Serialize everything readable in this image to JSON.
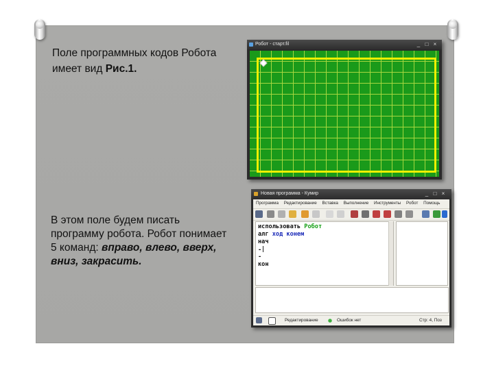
{
  "slide": {
    "paragraph1_text": "Поле  программных кодов Робота",
    "paragraph1_line2_prefix": "имеет вид ",
    "paragraph1_figure": "Рис.1.",
    "paragraph2_line1": "В  этом  поле  будем  писать",
    "paragraph2_line2": "программу  робота.  Робот  понимает",
    "paragraph2_line3_prefix": "5  команд:  ",
    "paragraph2_commands_a": "вправо,  влево,  вверх,",
    "paragraph2_commands_b": "вниз, закрасить."
  },
  "robot_window": {
    "title": "Робот - старт.fil",
    "minimize": "_",
    "maximize": "□",
    "close": "×"
  },
  "kumir_window": {
    "title": "Новая программа - Кумир",
    "minimize": "_",
    "maximize": "□",
    "close": "×",
    "menu": [
      "Программа",
      "Редактирование",
      "Вставка",
      "Выполнение",
      "Инструменты",
      "Робот",
      "Помощь"
    ],
    "code": {
      "line1_kw": "использовать",
      "line1_name": "Робот",
      "line2_kw": "алг",
      "line2_name": "ход конем",
      "line3": "нач",
      "line4": "-",
      "line5": "-",
      "line6": "кон"
    },
    "status": {
      "mode": "Редактирование",
      "errors": "Ошибок нет",
      "position": "Стр: 4, Поз"
    }
  },
  "colors": {
    "field_green": "#1a9a1a",
    "grid_line": "#a8d840",
    "field_border_yellow": "#f0f000",
    "board_gray": "#a9a9a7"
  }
}
